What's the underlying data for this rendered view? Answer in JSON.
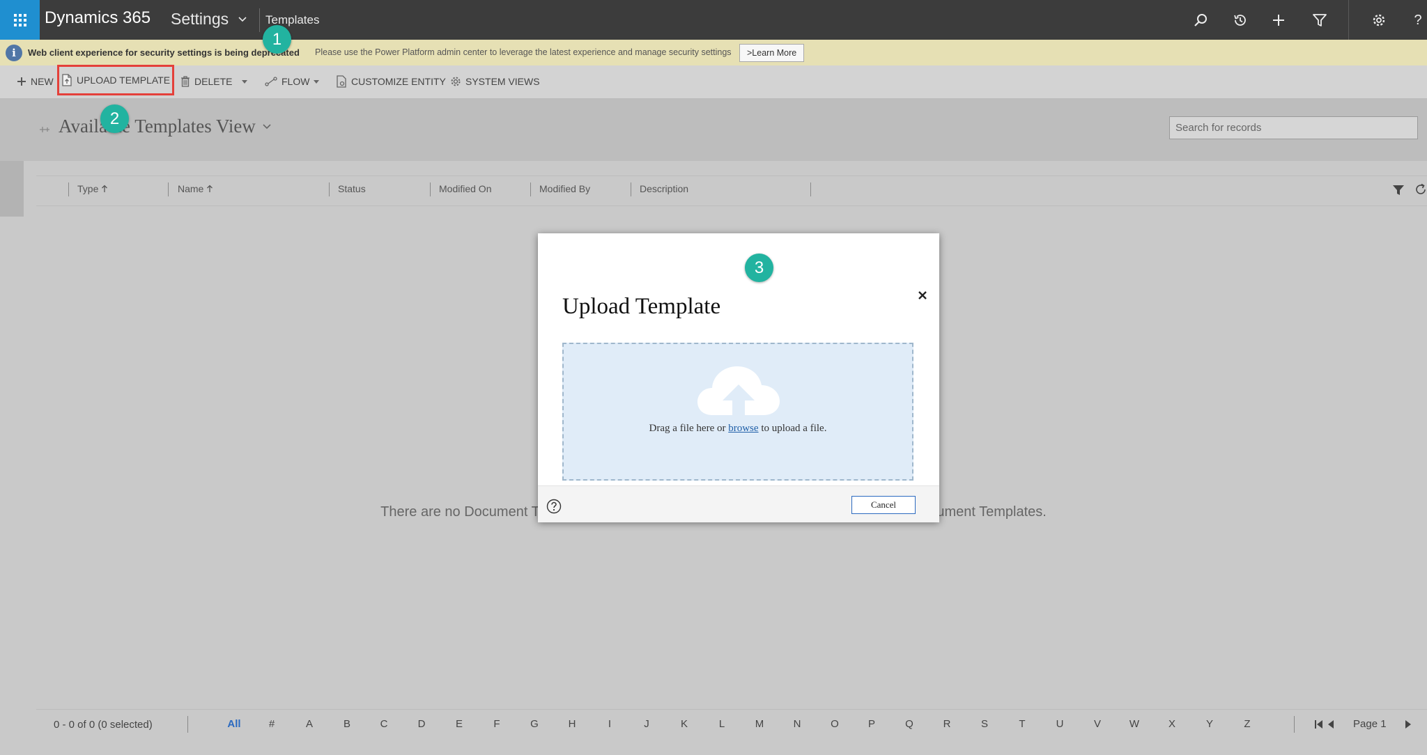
{
  "app": {
    "title": "Dynamics 365",
    "area": "Settings",
    "breadcrumb": "Templates"
  },
  "notice": {
    "bold_text": "Web client experience for security settings is being deprecated",
    "message": "Please use the Power Platform admin center to leverage the latest experience and manage security settings",
    "learn_more": ">Learn More"
  },
  "toolbar": {
    "new": "NEW",
    "upload_template": "UPLOAD TEMPLATE",
    "delete": "DELETE",
    "flow": "FLOW",
    "customize_entity": "CUSTOMIZE ENTITY",
    "system_views": "SYSTEM VIEWS"
  },
  "view": {
    "title": "Available Templates View"
  },
  "search": {
    "placeholder": "Search for records"
  },
  "grid": {
    "columns": [
      "Type",
      "Name",
      "Status",
      "Modified On",
      "Modified By",
      "Description"
    ],
    "empty_message": "There are no Document Templates. To get started, click Upload Template to add more Document Templates."
  },
  "footer": {
    "record_count": "0 - 0 of 0 (0 selected)",
    "letters": [
      "All",
      "#",
      "A",
      "B",
      "C",
      "D",
      "E",
      "F",
      "G",
      "H",
      "I",
      "J",
      "K",
      "L",
      "M",
      "N",
      "O",
      "P",
      "Q",
      "R",
      "S",
      "T",
      "U",
      "V",
      "W",
      "X",
      "Y",
      "Z"
    ],
    "page_label": "Page 1"
  },
  "dialog": {
    "title": "Upload Template",
    "drop_text_before": "Drag a file here or ",
    "drop_link": "browse",
    "drop_text_after": " to upload a file.",
    "cancel": "Cancel"
  },
  "markers": [
    "1",
    "2",
    "3"
  ],
  "colors": {
    "topbar": "#3c3c3c",
    "waffle": "#1f8fd0",
    "notice_bg": "#e6e0b4",
    "highlight_border": "#e4403a",
    "marker": "#22b3a0",
    "dropzone_bg": "#e0ecf8",
    "link": "#1f5fa8"
  }
}
